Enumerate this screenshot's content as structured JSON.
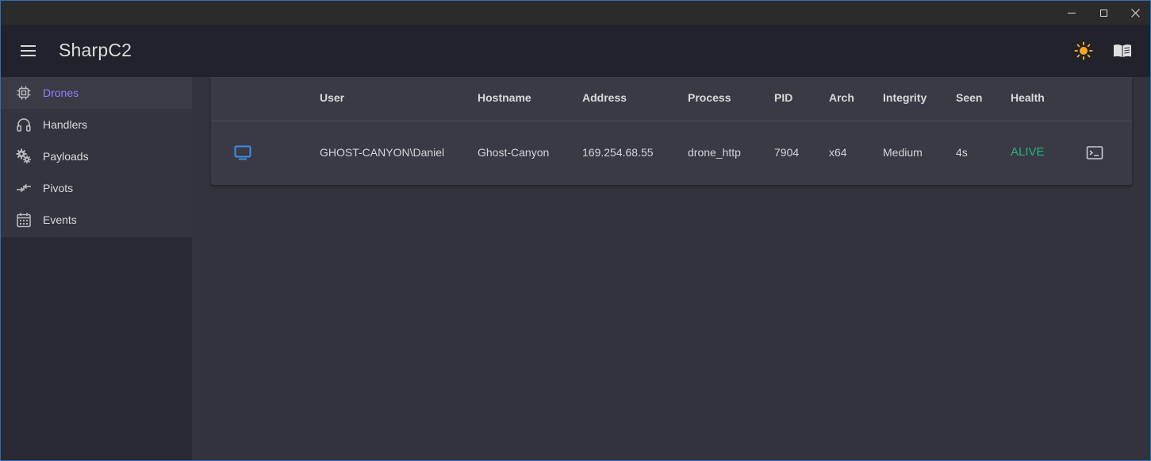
{
  "app": {
    "title": "SharpC2"
  },
  "window_controls": {
    "minimize": "minimize",
    "maximize": "maximize",
    "close": "close"
  },
  "appbar": {
    "icons": [
      "menu-icon",
      "sun-icon",
      "book-icon"
    ]
  },
  "sidebar": {
    "items": [
      {
        "label": "Drones",
        "icon": "chip-icon",
        "active": true
      },
      {
        "label": "Handlers",
        "icon": "headphones-icon",
        "active": false
      },
      {
        "label": "Payloads",
        "icon": "gears-icon",
        "active": false
      },
      {
        "label": "Pivots",
        "icon": "pivot-arrows-icon",
        "active": false
      },
      {
        "label": "Events",
        "icon": "calendar-icon",
        "active": false
      }
    ]
  },
  "table": {
    "headers": [
      "User",
      "Hostname",
      "Address",
      "Process",
      "PID",
      "Arch",
      "Integrity",
      "Seen",
      "Health"
    ],
    "rows": [
      {
        "icon": "monitor-icon",
        "user": "GHOST-CANYON\\Daniel",
        "hostname": "Ghost-Canyon",
        "address": "169.254.68.55",
        "process": "drone_http",
        "pid": "7904",
        "arch": "x64",
        "integrity": "Medium",
        "seen": "4s",
        "health": "ALIVE",
        "action_icon": "terminal-icon"
      }
    ]
  },
  "colors": {
    "accent": "#8e7fff",
    "alive": "#27b47a",
    "monitor": "#3f8ee6",
    "sun": "#f5a623"
  }
}
